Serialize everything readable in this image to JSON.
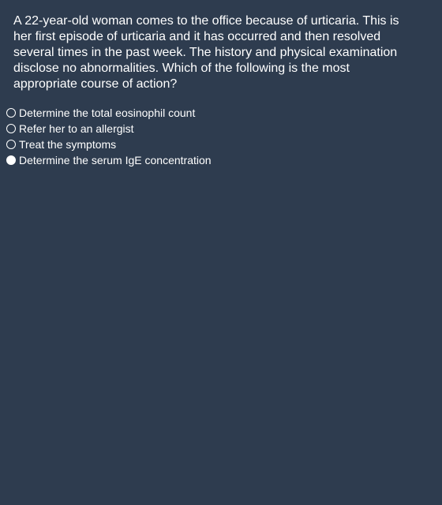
{
  "question": {
    "text": "A 22-year-old woman comes to the office because of urticaria. This is her first episode of urticaria and it has occurred and then resolved several times in the past week. The history and physical examination disclose no abnormalities. Which of the following is the most appropriate course of action?"
  },
  "options": [
    {
      "label": "Determine the total eosinophil count",
      "selected": false
    },
    {
      "label": "Refer her to an allergist",
      "selected": false
    },
    {
      "label": "Treat the symptoms",
      "selected": false
    },
    {
      "label": "Determine the serum IgE concentration",
      "selected": true
    }
  ]
}
